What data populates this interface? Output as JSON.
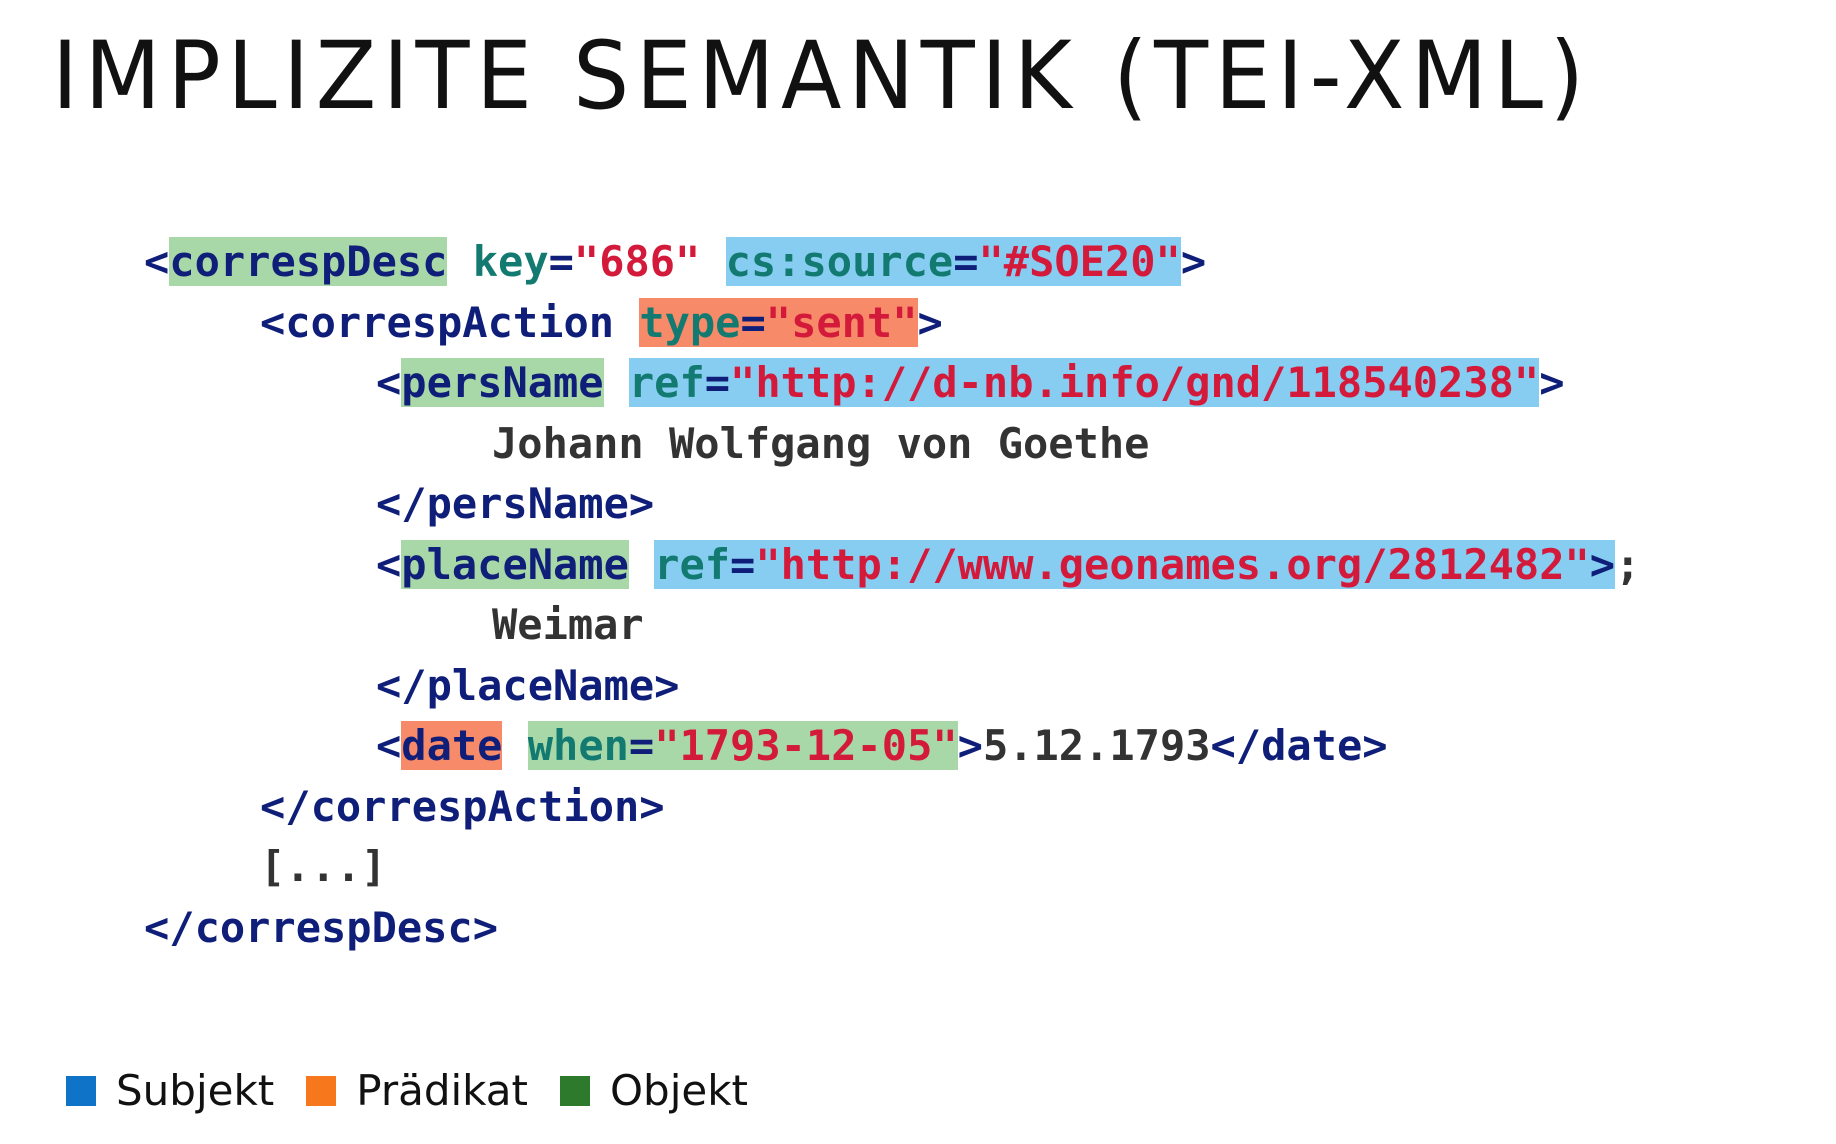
{
  "title": "IMPLIZITE SEMANTIK (TEI-XML)",
  "colors": {
    "subject": "#0f74c8",
    "predicate": "#f7771d",
    "object": "#2d7a2d",
    "highlight_green": "#a8d8a8",
    "highlight_blue": "#87cdf2",
    "highlight_orange": "#f78a68",
    "tag": "#0f1e78",
    "attribute": "#127a70",
    "value": "#d41a3b",
    "text": "#333333"
  },
  "code": {
    "l1": {
      "lt": "<",
      "el": "correspDesc",
      "a1": "key",
      "eq1": "=",
      "v1": "\"686\"",
      "a2": "cs:source",
      "eq2": "=",
      "v2": "\"#SOE20\"",
      "gt": ">"
    },
    "l2": {
      "lt": "<",
      "el": "correspAction",
      "a1": "type",
      "eq1": "=",
      "v1": "\"sent\"",
      "gt": ">"
    },
    "l3": {
      "lt": "<",
      "el": "persName",
      "a1": "ref",
      "eq1": "=",
      "v1": "\"http://d-nb.info/gnd/118540238\"",
      "gt": ">"
    },
    "l4": {
      "text": "Johann Wolfgang von Goethe"
    },
    "l5": {
      "close": "</persName>"
    },
    "l6": {
      "lt": "<",
      "el": "placeName",
      "a1": "ref",
      "eq1": "=",
      "v1": "\"http://www.geonames.org/2812482\"",
      "gt": ">",
      "semi": ";"
    },
    "l7": {
      "text": "Weimar"
    },
    "l8": {
      "close": "</placeName>"
    },
    "l9": {
      "lt": "<",
      "el": "date",
      "a1": "when",
      "eq1": "=",
      "v1": "\"1793-12-05\"",
      "gt": ">",
      "text": "5.12.1793",
      "close": "</date>"
    },
    "l10": {
      "close": "</correspAction>"
    },
    "l11": {
      "text": "[...]"
    },
    "l12": {
      "close": "</correspDesc>"
    }
  },
  "legend": [
    {
      "label": "Subjekt",
      "color": "#0f74c8"
    },
    {
      "label": "Prädikat",
      "color": "#f7771d"
    },
    {
      "label": "Objekt",
      "color": "#2d7a2d"
    }
  ]
}
